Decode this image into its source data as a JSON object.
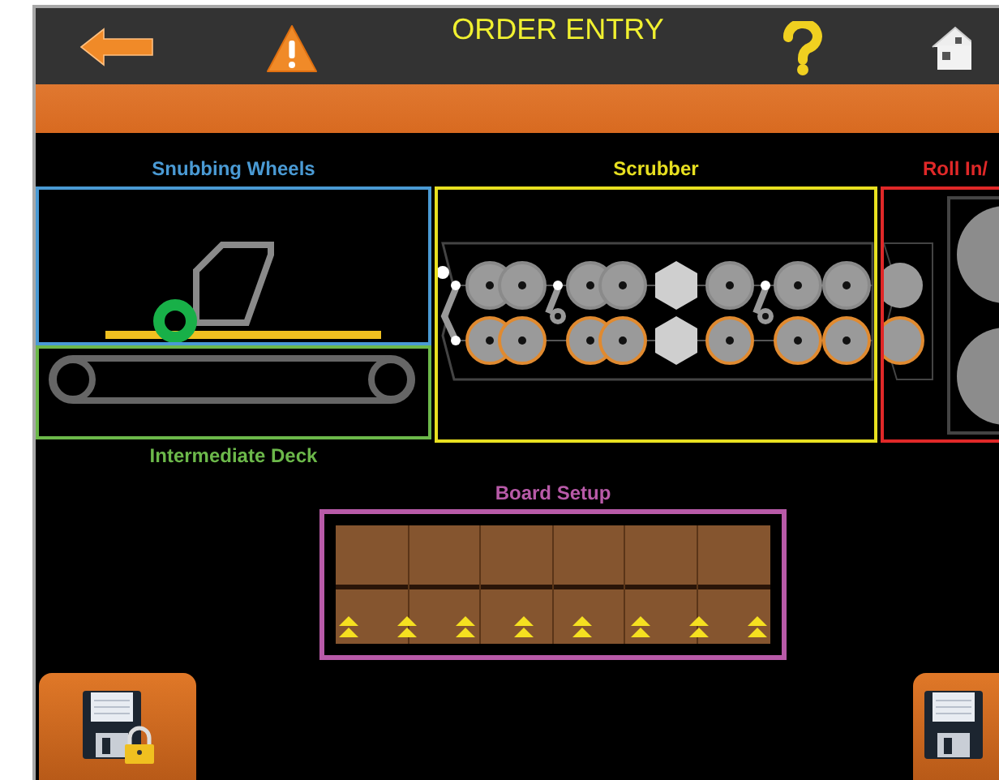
{
  "header": {
    "title": "ORDER ENTRY"
  },
  "sections": [
    {
      "label": "Snubbing Wheels",
      "color": "#4a9ad4"
    },
    {
      "label": "Intermediate Deck",
      "color": "#6cb84a"
    },
    {
      "label": "Scrubber",
      "color": "#e8e020"
    },
    {
      "label": "Roll In/",
      "color": "#e02828"
    },
    {
      "label": "Board Setup",
      "color": "#b85aa8"
    }
  ]
}
